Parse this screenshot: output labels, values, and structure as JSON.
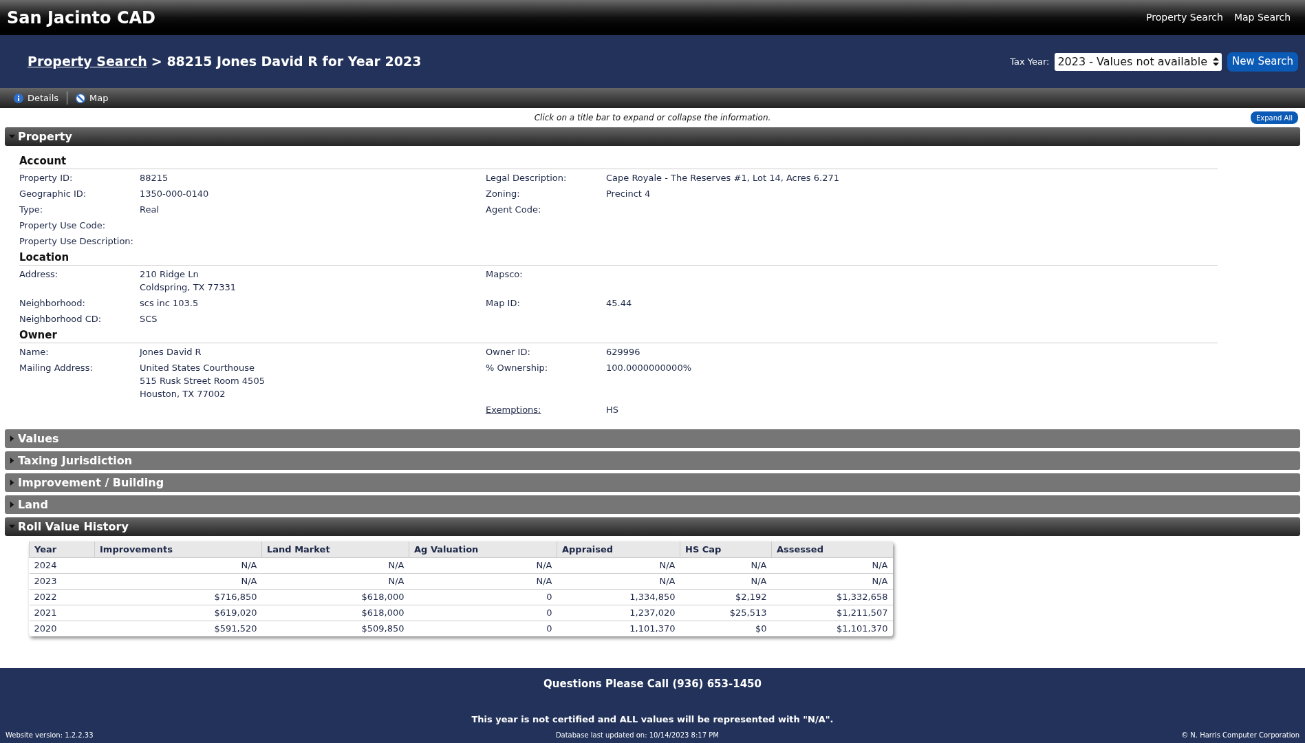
{
  "site_title": "San Jacinto CAD",
  "nav_links": [
    "Property Search",
    "Map Search"
  ],
  "breadcrumb": {
    "link": "Property Search",
    "title": "> 88215 Jones David R for Year 2023"
  },
  "tax_year": {
    "label": "Tax Year:",
    "value": "2023 - Values not available"
  },
  "new_search": "New Search",
  "tabs": [
    {
      "label": "Details",
      "kind": "info"
    },
    {
      "label": "Map",
      "kind": "map"
    }
  ],
  "hint": "Click on a title bar to expand or collapse the information.",
  "expand_all": "Expand All",
  "sections": [
    {
      "title": "Property",
      "expanded": true,
      "kind": "details",
      "groups": [
        {
          "title": "Account",
          "rows": [
            {
              "left": {
                "label": "Property ID:",
                "lines": [
                  "88215"
                ]
              },
              "right": {
                "label": "Legal Description:",
                "lines": [
                  "Cape Royale - The Reserves #1, Lot 14, Acres 6.271"
                ]
              }
            },
            {
              "left": {
                "label": "Geographic ID:",
                "lines": [
                  "1350-000-0140"
                ]
              },
              "right": {
                "label": "Zoning:",
                "lines": [
                  "Precinct 4"
                ]
              }
            },
            {
              "left": {
                "label": "Type:",
                "lines": [
                  "Real"
                ]
              },
              "right": {
                "label": "Agent Code:"
              }
            },
            {
              "left": {
                "label": "Property Use Code:"
              }
            },
            {
              "left": {
                "label": "Property Use Description:"
              }
            }
          ]
        },
        {
          "title": "Location",
          "rows": [
            {
              "left": {
                "label": "Address:",
                "lines": [
                  "210 Ridge Ln",
                  "Coldspring, TX 77331"
                ]
              },
              "right": {
                "label": "Mapsco:"
              }
            },
            {
              "left": {
                "label": "Neighborhood:",
                "lines": [
                  "scs inc 103.5"
                ]
              },
              "right": {
                "label": "Map ID:",
                "lines": [
                  "45.44"
                ]
              }
            },
            {
              "left": {
                "label": "Neighborhood CD:",
                "lines": [
                  "SCS"
                ]
              }
            }
          ]
        },
        {
          "title": "Owner",
          "rows": [
            {
              "left": {
                "label": "Name:",
                "lines": [
                  "Jones David R"
                ]
              },
              "right": {
                "label": "Owner ID:",
                "lines": [
                  "629996"
                ]
              }
            },
            {
              "left": {
                "label": "Mailing Address:",
                "lines": [
                  "United States Courthouse",
                  "515 Rusk Street Room 4505",
                  "Houston, TX 77002"
                ]
              },
              "right": {
                "label": "% Ownership:",
                "lines": [
                  "100.0000000000%"
                ]
              }
            },
            {
              "right": {
                "label": "Exemptions:",
                "lines": [
                  "HS"
                ],
                "link": true
              }
            }
          ]
        }
      ]
    },
    {
      "title": "Values",
      "expanded": false
    },
    {
      "title": "Taxing Jurisdiction",
      "expanded": false
    },
    {
      "title": "Improvement / Building",
      "expanded": false
    },
    {
      "title": "Land",
      "expanded": false
    },
    {
      "title": "Roll Value History",
      "expanded": true,
      "kind": "table",
      "table": {
        "columns": [
          "Year",
          "Improvements",
          "Land Market",
          "Ag Valuation",
          "Appraised",
          "HS Cap",
          "Assessed"
        ],
        "rows": [
          [
            "2024",
            "N/A",
            "N/A",
            "N/A",
            "N/A",
            "N/A",
            "N/A"
          ],
          [
            "2023",
            "N/A",
            "N/A",
            "N/A",
            "N/A",
            "N/A",
            "N/A"
          ],
          [
            "2022",
            "$716,850",
            "$618,000",
            "0",
            "1,334,850",
            "$2,192",
            "$1,332,658"
          ],
          [
            "2021",
            "$619,020",
            "$618,000",
            "0",
            "1,237,020",
            "$25,513",
            "$1,211,507"
          ],
          [
            "2020",
            "$591,520",
            "$509,850",
            "0",
            "1,101,370",
            "$0",
            "$1,101,370"
          ]
        ]
      }
    }
  ],
  "footer": {
    "phone": "Questions Please Call (936) 653-1450",
    "notice": "This year is not certified and ALL values will be represented with \"N/A\".",
    "version": "Website version: 1.2.2.33",
    "updated": "Database last updated on: 10/14/2023 8:17 PM",
    "copyright": "© N. Harris Computer Corporation"
  }
}
